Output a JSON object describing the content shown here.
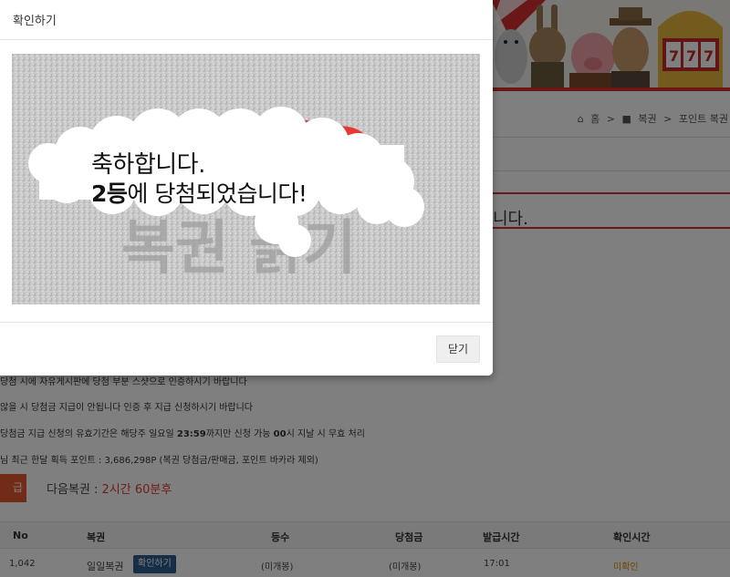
{
  "breadcrumb": {
    "home": "홈",
    "lottery": "복권",
    "current": "포인트 복권"
  },
  "notice_bar_text": "니다.",
  "info_lines": {
    "line1": "당첨 시에 자유게시판에 당첨 부분 스샷으로 인증하시기 바랍니다",
    "line2": "않을 시 당첨금 지급이 안됩니다 인증 후 지급 신청하시기 바랍니다",
    "line3_a": "당첨금 지급 신청의 유효기간은 해당주 일요일 ",
    "line3_b": "23:59",
    "line3_c": "까지만 신청 가능 ",
    "line3_d": "00",
    "line3_e": "시 지날 시 무효 처리",
    "line4": "님 최근 한달 획득 포인트 : 3,686,298P (복권 당첨금/판매금, 포인트 바카라 제외)"
  },
  "issue_button": "발급",
  "next_lottery": {
    "label": "다음복권 : ",
    "time": "2시간 60분후"
  },
  "table": {
    "headers": [
      "No",
      "복권",
      "등수",
      "당첨금",
      "발급시간",
      "확인시간"
    ],
    "row": {
      "no": "1,042",
      "name": "일일복권",
      "button": "확인하기",
      "rank": "(미개봉)",
      "prize": "(미개봉)",
      "issued": "17:01",
      "confirmed": "미확인"
    }
  },
  "modal": {
    "title": "확인하기",
    "congrats": "축하합니다.",
    "result_rank": "2등",
    "result_rest": "에 당첨되었습니다!",
    "close": "닫기"
  },
  "colors": {
    "accent_red": "#d32f2f",
    "button_blue": "#2f5d92",
    "issue_orange": "#e4572e"
  }
}
